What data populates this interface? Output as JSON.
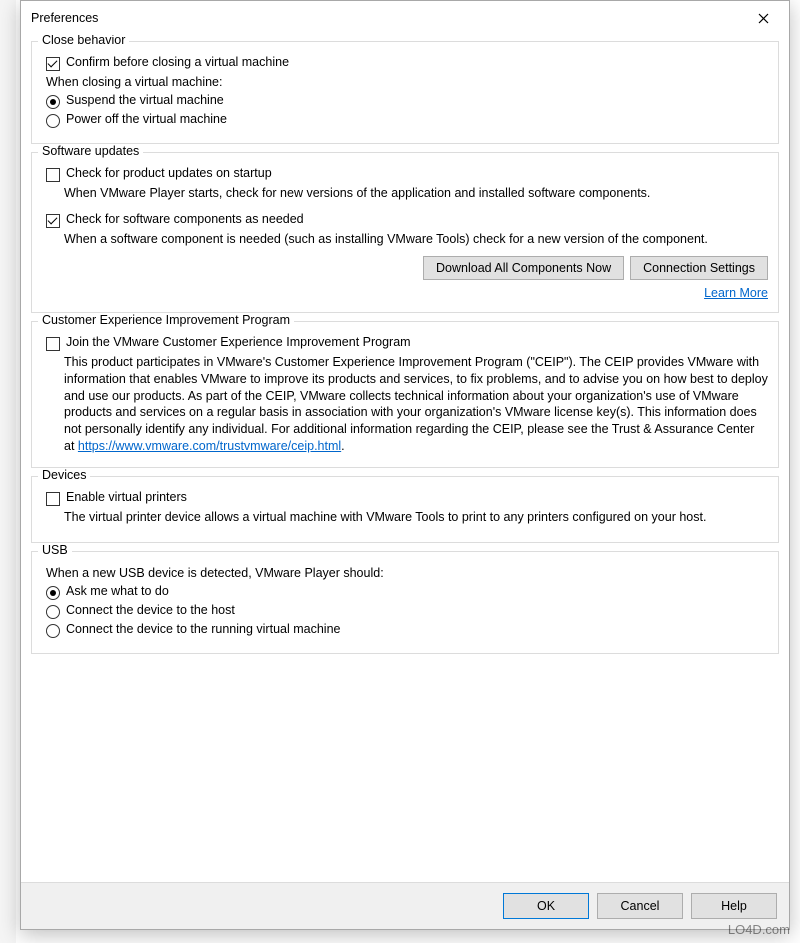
{
  "dialog": {
    "title": "Preferences"
  },
  "close_behavior": {
    "legend": "Close behavior",
    "confirm": "Confirm before closing a virtual machine",
    "when_closing": "When closing a virtual machine:",
    "suspend": "Suspend the virtual machine",
    "poweroff": "Power off the virtual machine"
  },
  "updates": {
    "legend": "Software updates",
    "check_startup": "Check for product updates on startup",
    "check_startup_desc": "When VMware Player starts, check for new versions of the application and installed software components.",
    "check_components": "Check for software components as needed",
    "check_components_desc": "When a software component is needed (such as installing VMware Tools) check for a new version of the component.",
    "download_btn": "Download All Components Now",
    "conn_btn": "Connection Settings",
    "learn_more": "Learn More"
  },
  "ceip": {
    "legend": "Customer Experience Improvement Program",
    "join": "Join the VMware Customer Experience Improvement Program",
    "text": "This product participates in VMware's Customer Experience Improvement Program (\"CEIP\"). The CEIP provides VMware with information that enables VMware to improve its products and services, to fix problems, and to advise you on how best to deploy and use our products. As part of the CEIP, VMware collects technical information about your organization's use of VMware products and services on a regular basis in association with your organization's VMware license key(s). This information does not personally identify any individual. For additional information regarding the CEIP, please see the Trust & Assurance Center at ",
    "url": "https://www.vmware.com/trustvmware/ceip.html"
  },
  "devices": {
    "legend": "Devices",
    "enable_printers": "Enable virtual printers",
    "desc": "The virtual printer device allows a virtual machine with VMware Tools to print to any printers configured on your host."
  },
  "usb": {
    "legend": "USB",
    "prompt": "When a new USB device is detected, VMware Player should:",
    "ask": "Ask me what to do",
    "host": "Connect the device to the host",
    "vm": "Connect the device to the running virtual machine"
  },
  "footer": {
    "ok": "OK",
    "cancel": "Cancel",
    "help": "Help"
  },
  "watermark": "LO4D.com"
}
